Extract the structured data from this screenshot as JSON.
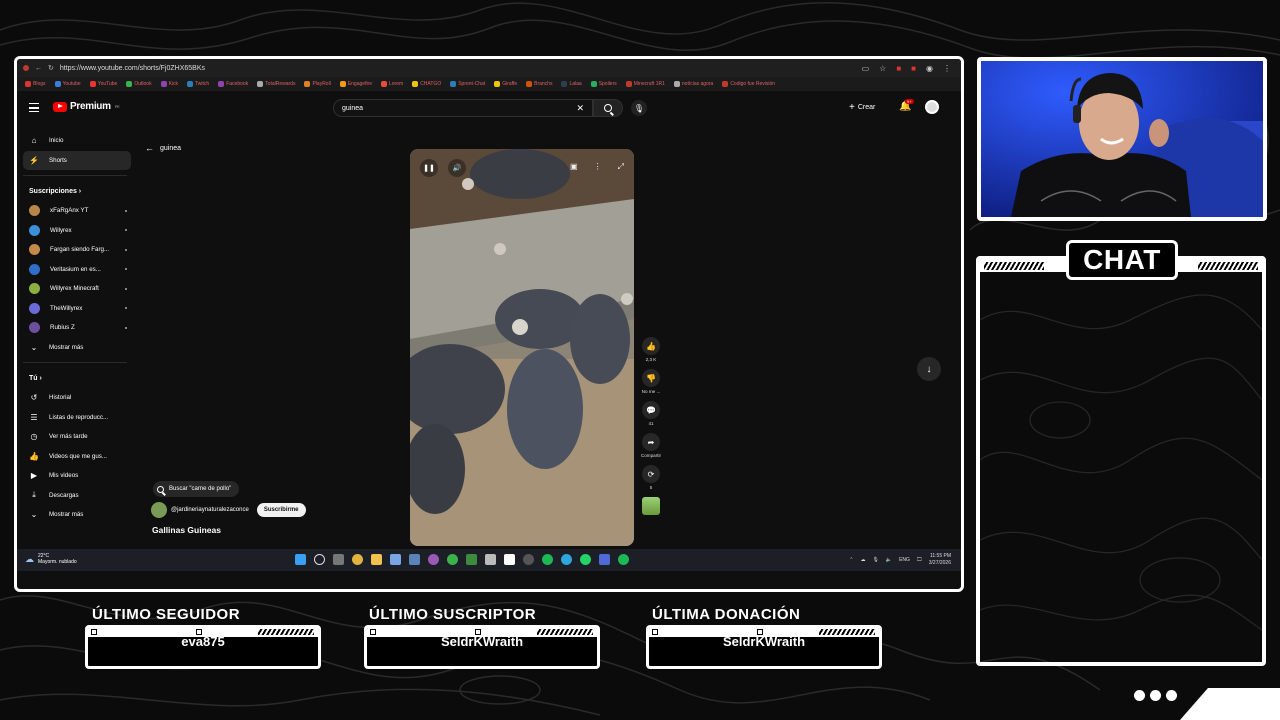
{
  "browser": {
    "url": "https://www.youtube.com/shorts/Fj0ZHX65BKs",
    "bookmarks": [
      "Blogs",
      "Youtube",
      "YouTube",
      "Outlook",
      "Kick",
      "Twitch",
      "Facebook",
      "TotalRewards",
      "PlayRoll",
      "Engagefire",
      "Lorem",
      "CHATGO",
      "Sprent-Chat",
      "Giraffe",
      "Branchs",
      "Lalaa",
      "Spoilers",
      "Minecraft 1R1",
      "notícias agora",
      "Codigo fue Revisión"
    ]
  },
  "youtube": {
    "logo": "Premium",
    "logo_sup": "PE",
    "search_value": "guinea",
    "create_label": "Crear",
    "notif_count": "9+",
    "sidebar": {
      "main": [
        {
          "icon": "⌂",
          "label": "Inicio"
        },
        {
          "icon": "⚡",
          "label": "Shorts"
        }
      ],
      "subs_heading": "Suscripciones  ›",
      "subs": [
        {
          "label": "xFaRgAnx YT",
          "color": "#b8864b"
        },
        {
          "label": "Willyrex",
          "color": "#3d8fd8"
        },
        {
          "label": "Fargan siendo Farg...",
          "color": "#c48a4a"
        },
        {
          "label": "Veritasium en es...",
          "color": "#2f6fc9"
        },
        {
          "label": "Willyrex Minecraft",
          "color": "#8bb040"
        },
        {
          "label": "TheWillyrex",
          "color": "#6b6bd8"
        },
        {
          "label": "Rubius Z",
          "color": "#6d4fa0"
        }
      ],
      "more": "Mostrar más",
      "you_heading": "Tú  ›",
      "you": [
        {
          "icon": "↺",
          "label": "Historial"
        },
        {
          "icon": "☰",
          "label": "Listas de reproducc..."
        },
        {
          "icon": "◷",
          "label": "Ver más tarde"
        },
        {
          "icon": "👍",
          "label": "Videos que me gus..."
        },
        {
          "icon": "▶",
          "label": "Mis videos"
        },
        {
          "icon": "⤓",
          "label": "Descargas"
        }
      ],
      "more2": "Mostrar más"
    },
    "short": {
      "back_label": "guinea",
      "likes": "2,3 K",
      "dislike": "No me ...",
      "comments": "41",
      "share": "Compartir",
      "remix": "5",
      "chip": "Buscar \"carne de pollo\"",
      "channel": "@jardineriaynaturalezaconce",
      "subscribe": "Suscribirme",
      "title": "Gallinas Guineas"
    }
  },
  "taskbar": {
    "temp": "22°C",
    "weather": "Mayorm. nublado",
    "lang": "ENG",
    "time": "11:55 PM",
    "date": "3/27/2026"
  },
  "overlay": {
    "chat_title": "CHAT",
    "follower_label": "ÚLTIMO SEGUIDOR",
    "follower_value": "eva875",
    "subscriber_label": "ÚLTIMO SUSCRIPTOR",
    "subscriber_value": "SeldrKWraith",
    "donation_label": "ÚLTIMA DONACIÓN",
    "donation_value": "SeldrKWraith"
  }
}
